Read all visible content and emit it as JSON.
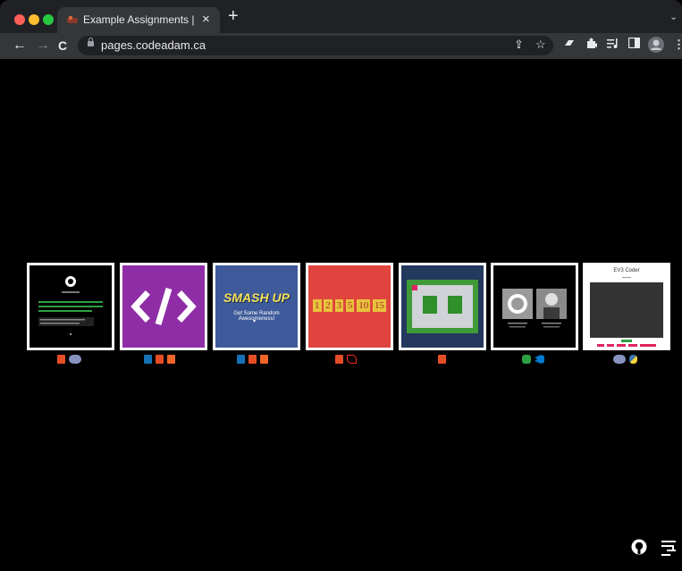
{
  "tab": {
    "title": "Example Assignments | Adam",
    "close": "×",
    "new_tab": "+",
    "menu": "⌄"
  },
  "toolbar": {
    "back": "←",
    "forward": "→",
    "reload": "C",
    "url": "pages.codeadam.ca"
  },
  "icons": {
    "share": "⇪",
    "bookmark": "☆",
    "extensions": "puzzle-icon",
    "media": "media-icon",
    "sidebar": "sidebar-icon",
    "profile": "avatar-icon",
    "menu": "⋮"
  },
  "projects": [
    {
      "name": "terminal-project",
      "screen_text": [
        "codeadam.ca",
        "Welcome to the command line"
      ],
      "tech": [
        "html5",
        "php"
      ]
    },
    {
      "name": "code-project",
      "screen_text": [
        "</>"
      ],
      "tech": [
        "css3",
        "html5",
        "orange5"
      ]
    },
    {
      "name": "smash-up-project",
      "screen_text": [
        "SMASH UP",
        "Get Some Random Awesomeness!"
      ],
      "tech": [
        "css3",
        "html5",
        "orange5"
      ]
    },
    {
      "name": "numbers-project",
      "screen_text": [
        "1",
        "2",
        "3",
        "5",
        "10",
        "15"
      ],
      "tech": [
        "html5",
        "laravel"
      ]
    },
    {
      "name": "game-board-project",
      "screen_text": [],
      "tech": [
        "html5"
      ]
    },
    {
      "name": "github-profile-project",
      "screen_text": [],
      "tech": [
        "gh",
        "vscode"
      ]
    },
    {
      "name": "ev3-coder-project",
      "screen_text": [
        "EV3 Coder"
      ],
      "tech": [
        "php",
        "python"
      ]
    }
  ],
  "footer": {
    "github": "github-icon",
    "logo": "codeadam-logo-icon"
  },
  "colors": {
    "background": "#000000",
    "tabstrip": "#202124",
    "toolbar": "#35363a"
  }
}
